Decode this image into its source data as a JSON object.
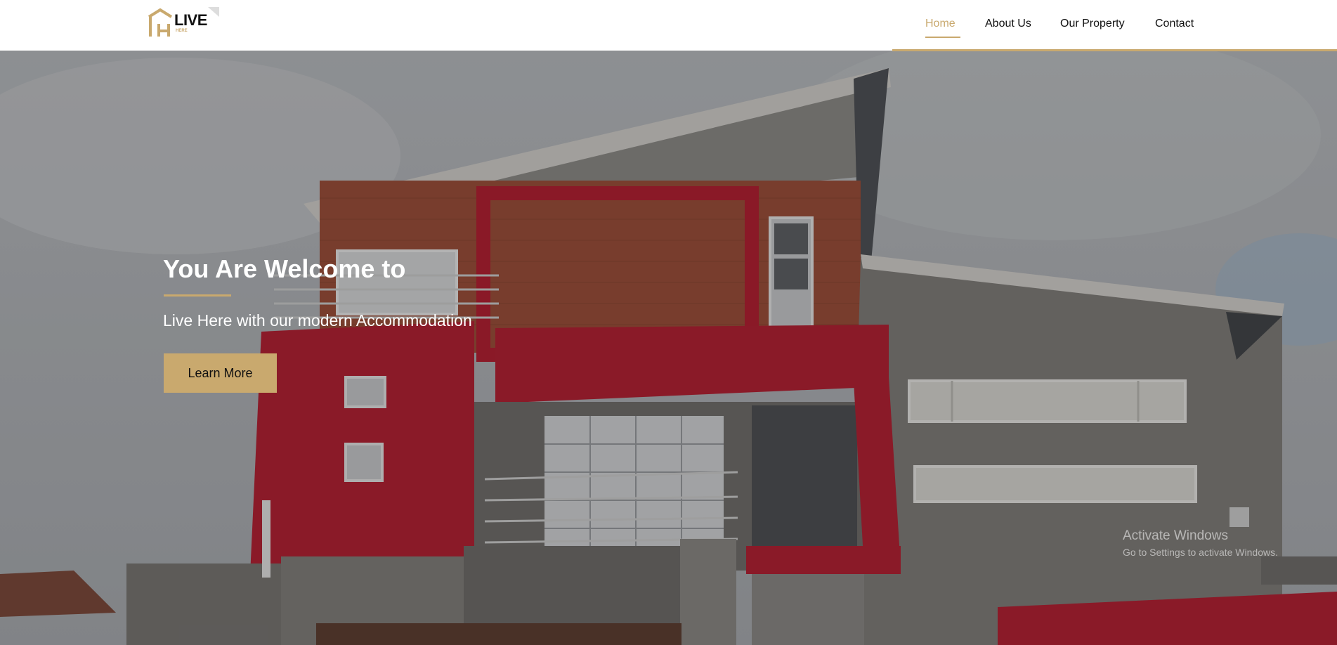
{
  "brand": {
    "name": "LIVE",
    "sub": "HERE",
    "accent_color": "#c9a96e"
  },
  "nav": {
    "items": [
      {
        "label": "Home",
        "active": true
      },
      {
        "label": "About Us",
        "active": false
      },
      {
        "label": "Our Property",
        "active": false
      },
      {
        "label": "Contact",
        "active": false
      }
    ]
  },
  "hero": {
    "title": "You Are Welcome to",
    "subtitle": "Live Here with our modern Accommodation",
    "cta_label": "Learn More",
    "image": "modern-house-photo"
  },
  "watermark": {
    "title": "Activate Windows",
    "subtitle": "Go to Settings to activate Windows."
  }
}
